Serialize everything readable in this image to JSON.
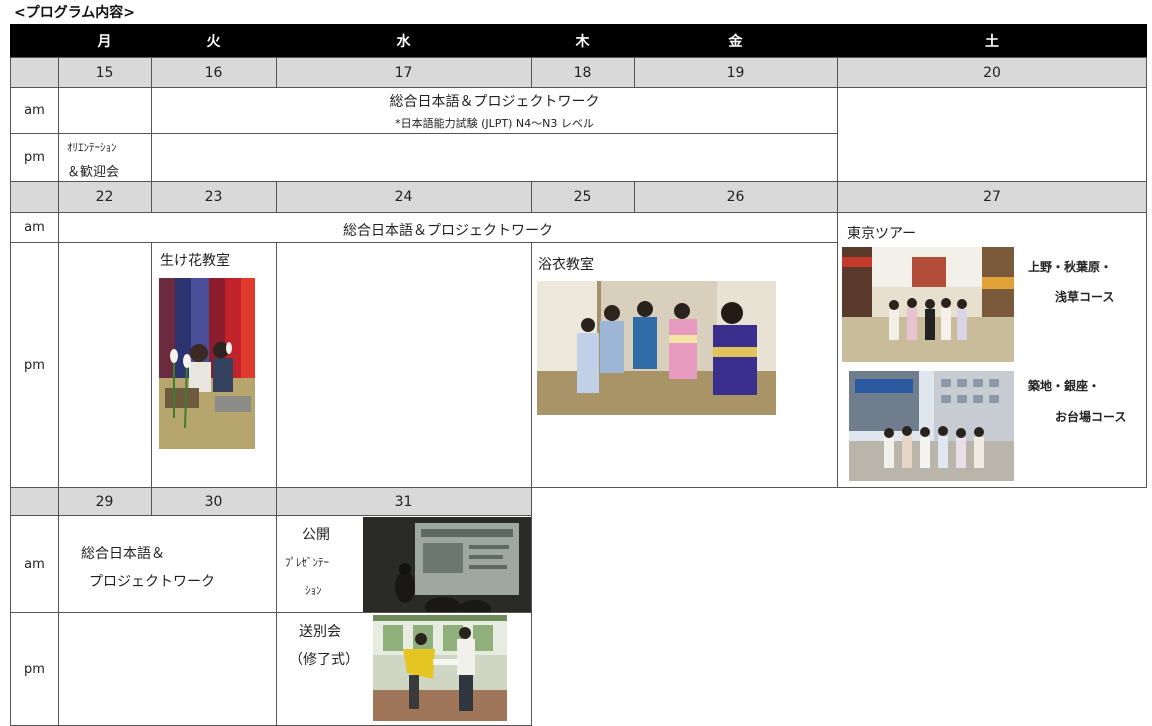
{
  "title": "<プログラム内容>",
  "weekdays": [
    "月",
    "火",
    "水",
    "木",
    "金",
    "土"
  ],
  "weeks": [
    {
      "dates": [
        "15",
        "16",
        "17",
        "18",
        "19",
        "20"
      ]
    },
    {
      "dates": [
        "22",
        "23",
        "24",
        "25",
        "26",
        "27"
      ]
    },
    {
      "dates": [
        "29",
        "30",
        "31"
      ]
    }
  ],
  "period_labels": {
    "am": "am",
    "pm": "pm"
  },
  "week1": {
    "am_main": "総合日本語＆プロジェクトワーク",
    "am_note": "*日本語能力試験 (JLPT) N4〜N3 レベル",
    "pm_mon_line1": "ｵﾘｴﾝﾃｰｼｮﾝ",
    "pm_mon_line2": "＆歓迎会"
  },
  "week2": {
    "am_main": "総合日本語＆プロジェクトワーク",
    "ikebana": "生け花教室",
    "yukata": "浴衣教室",
    "tokyo_tour": "東京ツアー",
    "course1_line1": "上野・秋葉原・",
    "course1_line2": "浅草コース",
    "course2_line1": "築地・銀座・",
    "course2_line2": "お台場コース"
  },
  "week3": {
    "am_line1": "総合日本語＆",
    "am_line2": "プロジェクトワーク",
    "pres_line1": "公開",
    "pres_line2": "ﾌﾟﾚｾﾞﾝﾃｰ",
    "pres_line3": "ｼｮﾝ",
    "farewell_line1": "送別会",
    "farewell_line2": "（修了式）"
  }
}
